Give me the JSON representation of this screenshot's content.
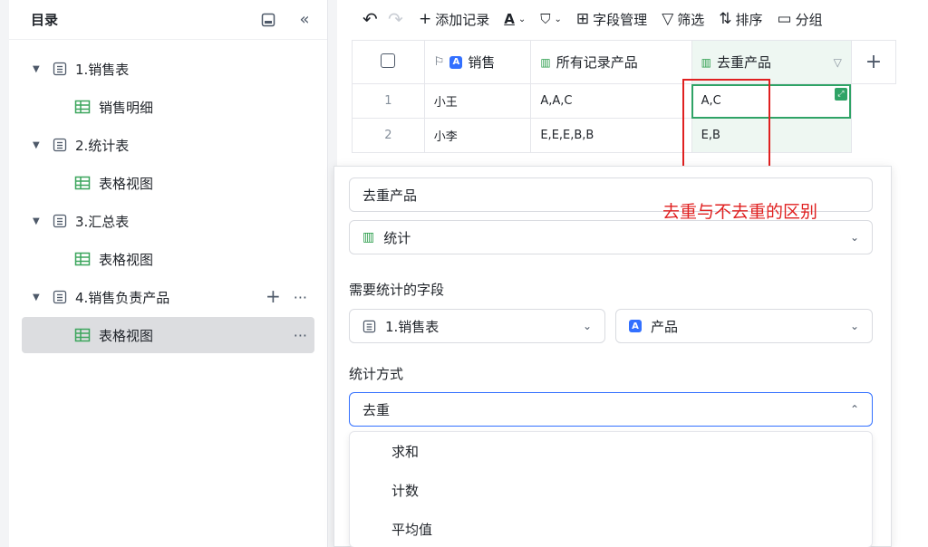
{
  "sidebar": {
    "title": "目录",
    "items": [
      {
        "label": "1.销售表",
        "type": "table"
      },
      {
        "label": "销售明细",
        "type": "view"
      },
      {
        "label": "2.统计表",
        "type": "table"
      },
      {
        "label": "表格视图",
        "type": "view"
      },
      {
        "label": "3.汇总表",
        "type": "table"
      },
      {
        "label": "表格视图",
        "type": "view"
      },
      {
        "label": "4.销售负责产品",
        "type": "table"
      },
      {
        "label": "表格视图",
        "type": "view",
        "selected": true
      }
    ]
  },
  "toolbar": {
    "add_record": "添加记录",
    "font_icon": "A",
    "field_manage": "字段管理",
    "filter": "筛选",
    "sort": "排序",
    "group": "分组"
  },
  "grid": {
    "headers": {
      "name": "销售",
      "all_products": "所有记录产品",
      "dedup_products": "去重产品"
    },
    "rows": [
      {
        "num": "1",
        "name": "小王",
        "all": "A,A,C",
        "dedup": "A,C"
      },
      {
        "num": "2",
        "name": "小李",
        "all": "E,E,E,B,B",
        "dedup": "E,B"
      }
    ]
  },
  "panel": {
    "field_name": "去重产品",
    "field_type": "统计",
    "annotation": "去重与不去重的区别",
    "stat_field_label": "需要统计的字段",
    "source_table": "1.销售表",
    "source_field": "产品",
    "method_label": "统计方式",
    "method_value": "去重",
    "options": [
      "求和",
      "计数",
      "平均值"
    ]
  },
  "colors": {
    "accent_green": "#2fa366",
    "accent_blue": "#3370ff",
    "annotation_red": "#e02020"
  }
}
